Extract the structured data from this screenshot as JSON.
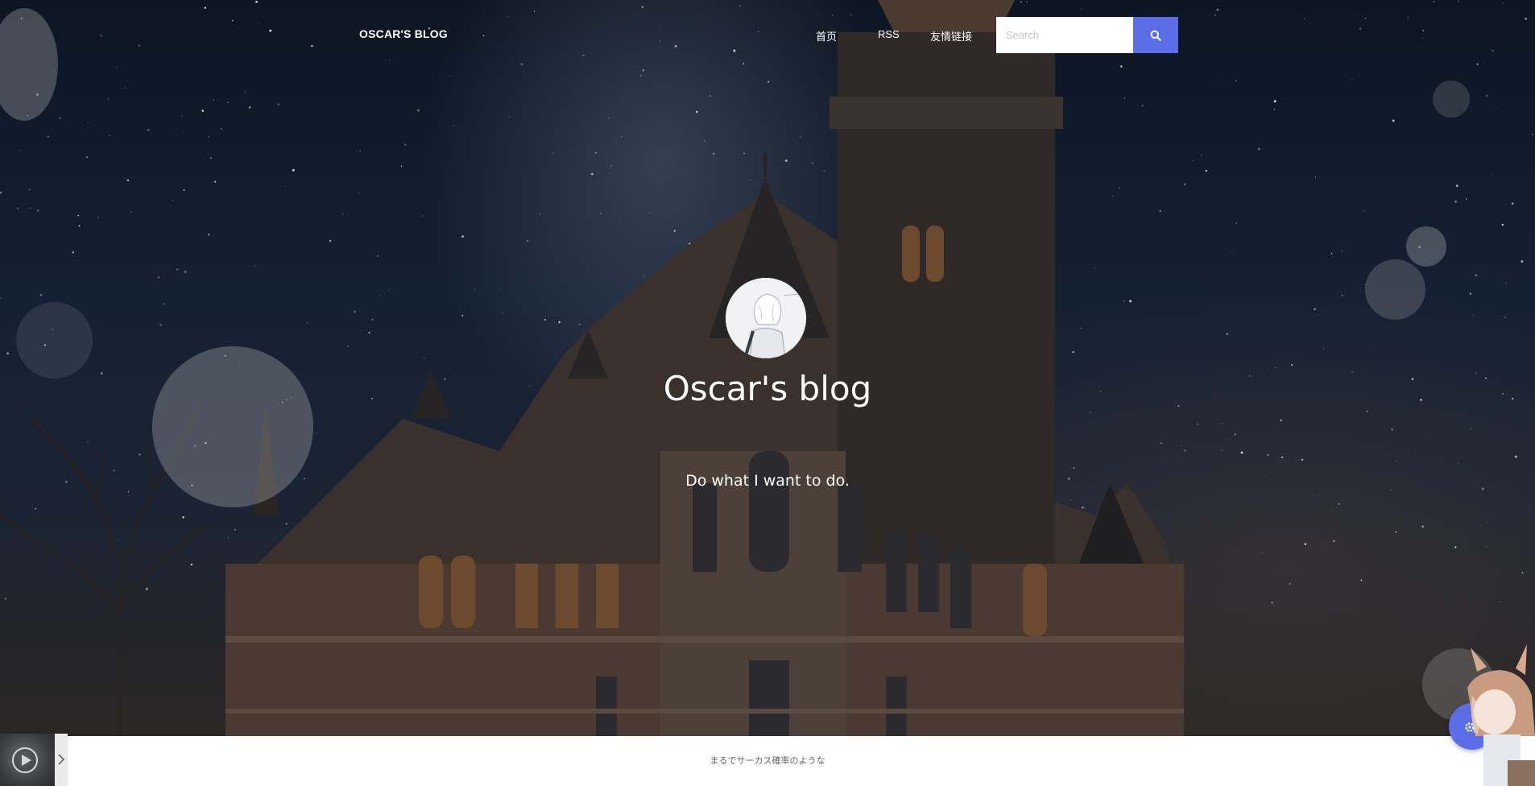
{
  "nav": {
    "brand": "OSCAR'S BLOG",
    "links": [
      "首页",
      "RSS",
      "友情链接"
    ],
    "search_placeholder": "Search"
  },
  "hero": {
    "title": "Oscar's blog",
    "subtitle": "Do what I want to do."
  },
  "player": {
    "lyrics": "まるでサーカス確率のような"
  },
  "colors": {
    "accent": "#5b6ee8"
  },
  "icons": {
    "search": "search-icon",
    "play": "play-icon",
    "settings": "gears-icon",
    "toggle": "chevron-right-icon"
  }
}
